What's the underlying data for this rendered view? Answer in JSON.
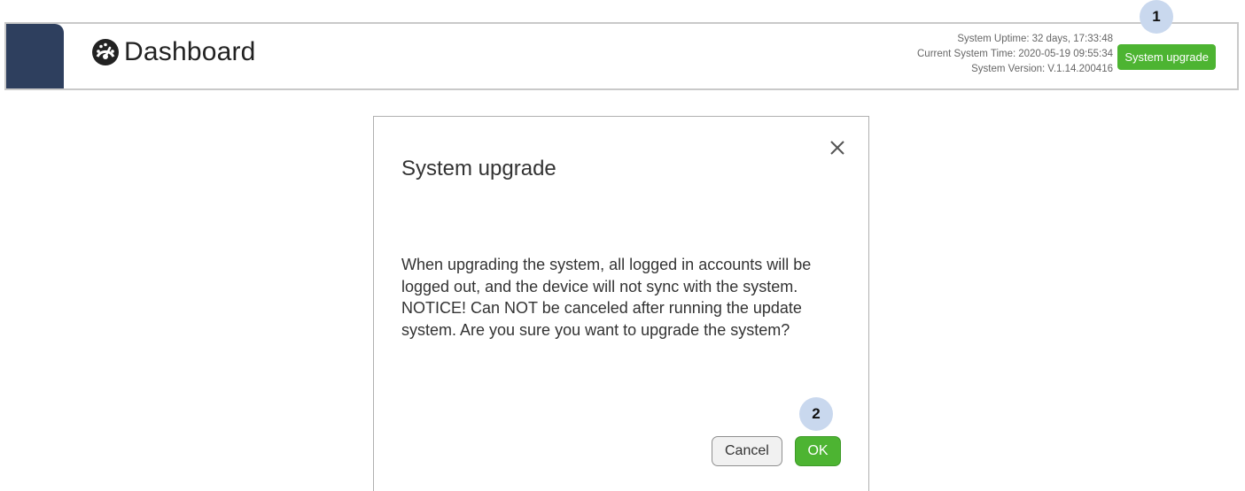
{
  "header": {
    "title": "Dashboard",
    "icon": "dashboard-gauge-icon",
    "status": [
      {
        "label": "System Uptime:",
        "value": "32 days, 17:33:48"
      },
      {
        "label": "Current System Time:",
        "value": "2020-05-19 09:55:34"
      },
      {
        "label": "System Version:",
        "value": "V.1.14.200416"
      }
    ],
    "upgrade_button_label": "System upgrade"
  },
  "markers": {
    "step1": "1",
    "step2": "2"
  },
  "dialog": {
    "title": "System upgrade",
    "close_icon": "close-icon",
    "message": "When upgrading the system, all logged in accounts will be logged out, and the device will not sync with the system. NOTICE! Can NOT be canceled after running the update system. Are you sure you want to upgrade the system?",
    "cancel_label": "Cancel",
    "ok_label": "OK"
  },
  "colors": {
    "sidebar": "#2e3f5e",
    "accent_green": "#4db432",
    "marker_bg": "#c9d8ee"
  }
}
